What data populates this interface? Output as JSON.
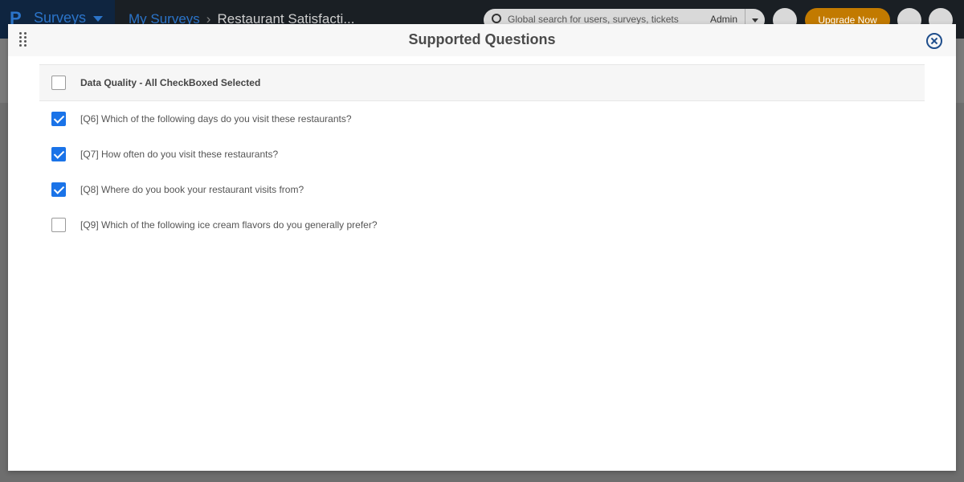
{
  "app": {
    "logo_glyph": "P",
    "name": "Surveys",
    "breadcrumb": [
      "My Surveys",
      "Restaurant Satisfacti..."
    ],
    "search_placeholder": "Global search for users, surveys, tickets",
    "search_scope": "Admin",
    "upgrade_label": "Upgrade Now"
  },
  "modal": {
    "title": "Supported Questions",
    "select_all": {
      "label": "Data Quality - All CheckBoxed Selected",
      "checked": false
    },
    "questions": [
      {
        "label": "[Q6] Which of the following days do you visit these restaurants?",
        "checked": true
      },
      {
        "label": "[Q7] How often do you visit these restaurants?",
        "checked": true
      },
      {
        "label": "[Q8] Where do you book your restaurant visits from?",
        "checked": true
      },
      {
        "label": "[Q9] Which of the following ice cream flavors do you generally prefer?",
        "checked": false
      }
    ]
  },
  "colors": {
    "checkbox_checked": "#1a73e8",
    "close_icon": "#1f4e8c",
    "upgrade_button": "#c27a00"
  }
}
